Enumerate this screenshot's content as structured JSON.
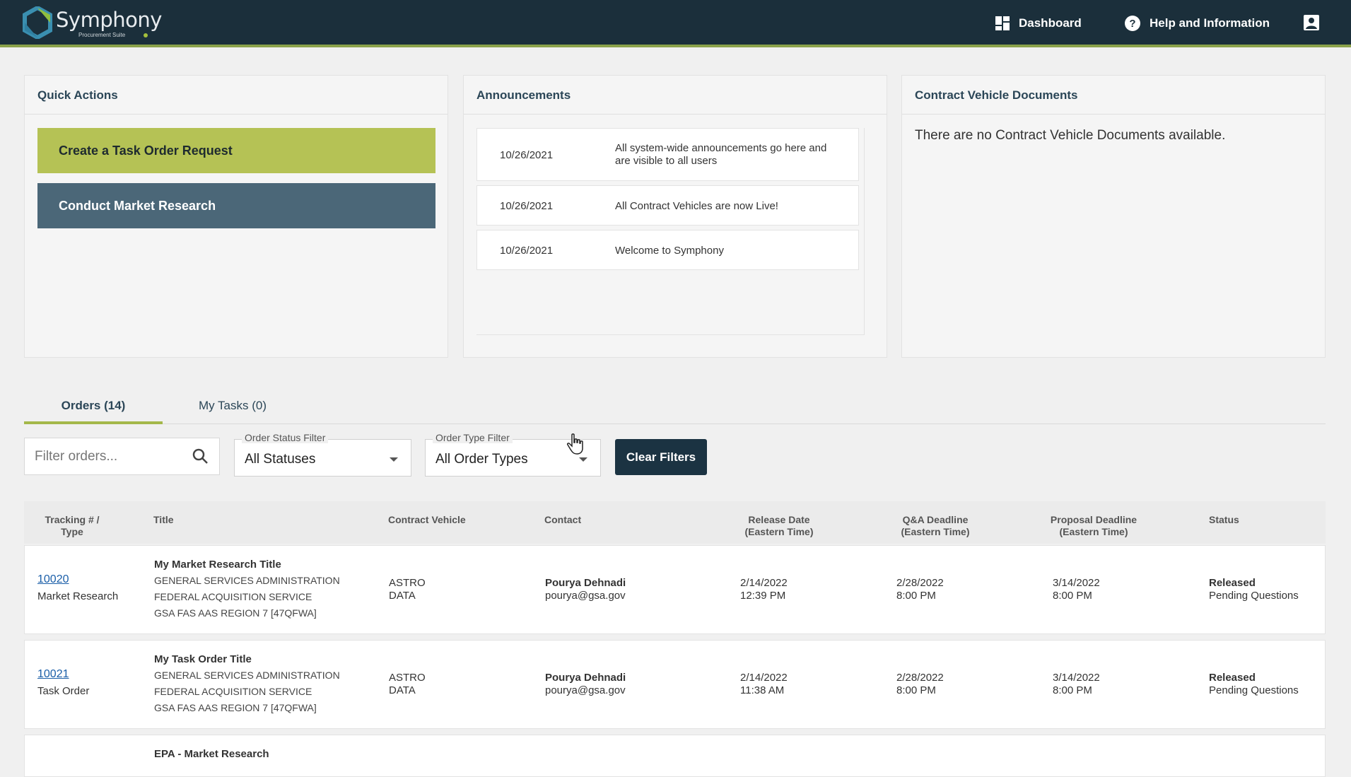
{
  "app": {
    "name": "Symphony",
    "tagline": "Procurement Suite"
  },
  "nav": {
    "dashboard_label": "Dashboard",
    "help_label": "Help and Information"
  },
  "quick_actions": {
    "title": "Quick Actions",
    "buttons": [
      "Create a Task Order Request",
      "Conduct Market Research"
    ]
  },
  "announcements": {
    "title": "Announcements",
    "items": [
      {
        "date": "10/26/2021",
        "text": "All system-wide announcements go here and are visible to all users"
      },
      {
        "date": "10/26/2021",
        "text": "All Contract Vehicles are now Live!"
      },
      {
        "date": "10/26/2021",
        "text": "Welcome to Symphony"
      }
    ]
  },
  "contract_vehicle_documents": {
    "title": "Contract Vehicle Documents",
    "empty_text": "There are no Contract Vehicle Documents available."
  },
  "tabs": [
    {
      "label": "Orders (14)",
      "active": true
    },
    {
      "label": "My Tasks (0)",
      "active": false
    }
  ],
  "filters": {
    "search_placeholder": "Filter orders...",
    "status_label": "Order Status Filter",
    "status_value": "All Statuses",
    "type_label": "Order Type Filter",
    "type_value": "All Order Types",
    "clear_label": "Clear Filters"
  },
  "table": {
    "headers": {
      "tracking": "Tracking # /",
      "tracking2": "Type",
      "title": "Title",
      "vehicle": "Contract Vehicle",
      "contact": "Contact",
      "release": "Release Date",
      "release2": "(Eastern Time)",
      "qa": "Q&A Deadline",
      "qa2": "(Eastern Time)",
      "proposal": "Proposal Deadline",
      "proposal2": "(Eastern Time)",
      "status": "Status"
    },
    "rows": [
      {
        "tracking": "10020",
        "type": "Market Research",
        "title": "My Market Research Title",
        "org1": "GENERAL SERVICES ADMINISTRATION",
        "org2": "FEDERAL ACQUISITION SERVICE",
        "org3": "GSA FAS AAS REGION 7 [47QFWA]",
        "vehicle1": "ASTRO",
        "vehicle2": "DATA",
        "contact_name": "Pourya Dehnadi",
        "contact_email": "pourya@gsa.gov",
        "release_date": "2/14/2022",
        "release_time": "12:39 PM",
        "qa_date": "2/28/2022",
        "qa_time": "8:00 PM",
        "proposal_date": "3/14/2022",
        "proposal_time": "8:00 PM",
        "status": "Released",
        "substatus": "Pending Questions"
      },
      {
        "tracking": "10021",
        "type": "Task Order",
        "title": "My Task Order Title",
        "org1": "GENERAL SERVICES ADMINISTRATION",
        "org2": "FEDERAL ACQUISITION SERVICE",
        "org3": "GSA FAS AAS REGION 7 [47QFWA]",
        "vehicle1": "ASTRO",
        "vehicle2": "DATA",
        "contact_name": "Pourya Dehnadi",
        "contact_email": "pourya@gsa.gov",
        "release_date": "2/14/2022",
        "release_time": "11:38 AM",
        "qa_date": "2/28/2022",
        "qa_time": "8:00 PM",
        "proposal_date": "3/14/2022",
        "proposal_time": "8:00 PM",
        "status": "Released",
        "substatus": "Pending Questions"
      },
      {
        "title": "EPA - Market Research"
      }
    ]
  },
  "icons": {
    "dashboard": "dashboard-grid-icon",
    "help": "question-circle-icon",
    "user": "account-box-icon",
    "search": "search-icon",
    "cursor": "hand-pointer-icon"
  },
  "colors": {
    "topbar": "#1b2f3b",
    "accent_green": "#b5c255",
    "slate_button": "#4b6778",
    "dark_button": "#1b3342",
    "link": "#1a5ea8"
  }
}
